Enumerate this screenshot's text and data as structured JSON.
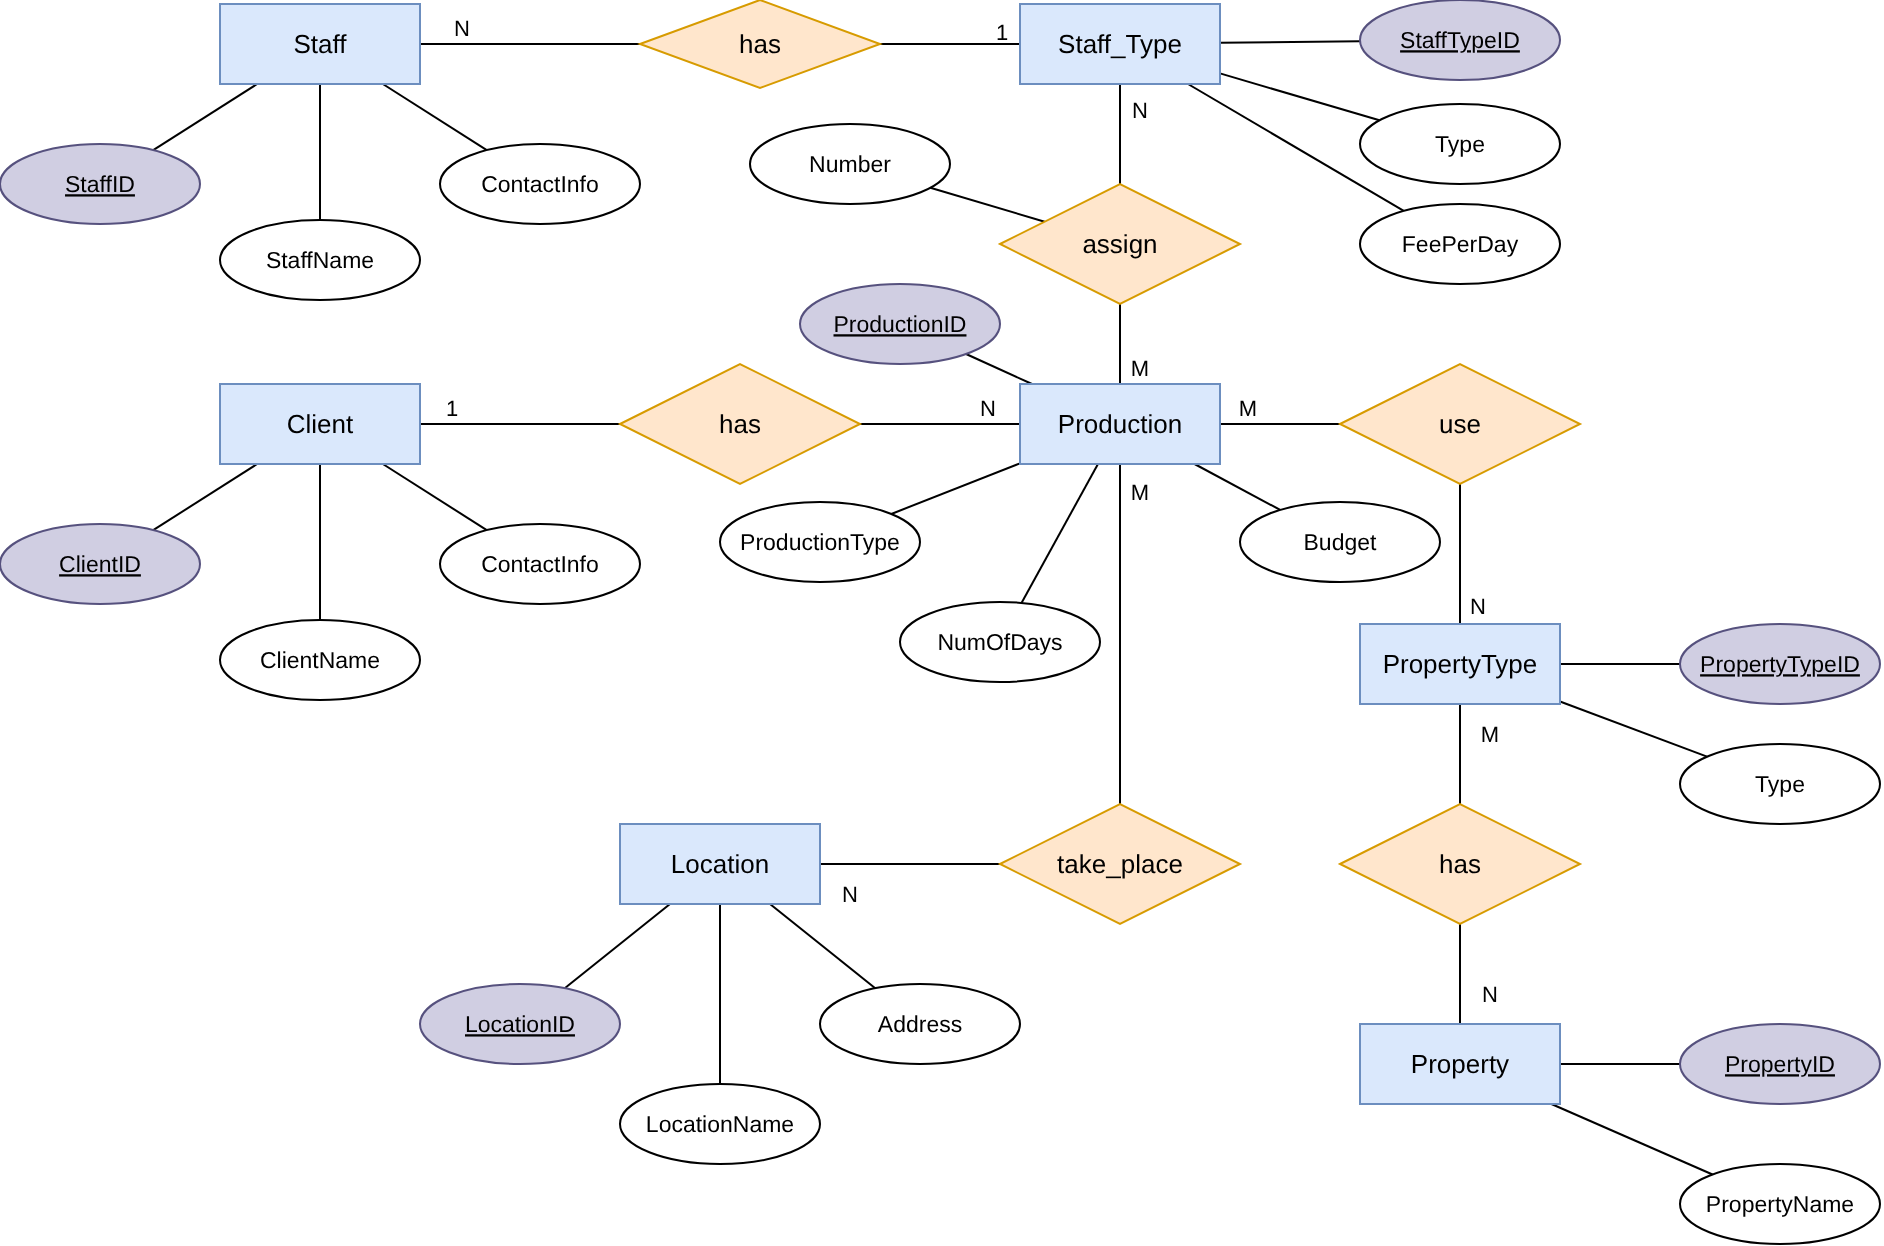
{
  "diagram": {
    "nodes": [
      {
        "kind": "entity",
        "text": "Staff"
      },
      {
        "kind": "relationship",
        "text": "has"
      },
      {
        "kind": "entity",
        "text": "Staff_Type"
      },
      {
        "kind": "attribute",
        "text": "StaffTypeID",
        "key": true
      },
      {
        "kind": "attribute",
        "text": "StaffID",
        "key": true
      },
      {
        "kind": "attribute",
        "text": "Number",
        "key": false
      },
      {
        "kind": "attribute",
        "text": "Type",
        "key": false
      },
      {
        "kind": "attribute",
        "text": "ContactInfo",
        "key": false
      },
      {
        "kind": "relationship",
        "text": "assign"
      },
      {
        "kind": "attribute",
        "text": "FeePerDay",
        "key": false
      },
      {
        "kind": "attribute",
        "text": "StaffName",
        "key": false
      },
      {
        "kind": "attribute",
        "text": "ProductionID",
        "key": true
      },
      {
        "kind": "entity",
        "text": "Client"
      },
      {
        "kind": "relationship",
        "text": "has"
      },
      {
        "kind": "entity",
        "text": "Production"
      },
      {
        "kind": "relationship",
        "text": "use"
      },
      {
        "kind": "attribute",
        "text": "Budget",
        "key": false
      },
      {
        "kind": "attribute",
        "text": "ProductionType",
        "key": false
      },
      {
        "kind": "attribute",
        "text": "ClientID",
        "key": true
      },
      {
        "kind": "attribute",
        "text": "ContactInfo",
        "key": false
      },
      {
        "kind": "attribute",
        "text": "NumOfDays",
        "key": false
      },
      {
        "kind": "attribute",
        "text": "ClientName",
        "key": false
      },
      {
        "kind": "entity",
        "text": "PropertyType"
      },
      {
        "kind": "attribute",
        "text": "PropertyTypeID",
        "key": true
      },
      {
        "kind": "attribute",
        "text": "Type",
        "key": false
      },
      {
        "kind": "entity",
        "text": "Location"
      },
      {
        "kind": "relationship",
        "text": "take_place"
      },
      {
        "kind": "relationship",
        "text": "has"
      },
      {
        "kind": "attribute",
        "text": "LocationID",
        "key": true
      },
      {
        "kind": "attribute",
        "text": "Address",
        "key": false
      },
      {
        "kind": "entity",
        "text": "Property"
      },
      {
        "kind": "attribute",
        "text": "PropertyID",
        "key": true
      },
      {
        "kind": "attribute",
        "text": "LocationName",
        "key": false
      },
      {
        "kind": "attribute",
        "text": "PropertyName",
        "key": false
      }
    ],
    "cardinalities": [
      "N",
      "1",
      "N",
      "M",
      "1",
      "N",
      "M",
      "N",
      "M",
      "N",
      "M",
      "N"
    ]
  }
}
